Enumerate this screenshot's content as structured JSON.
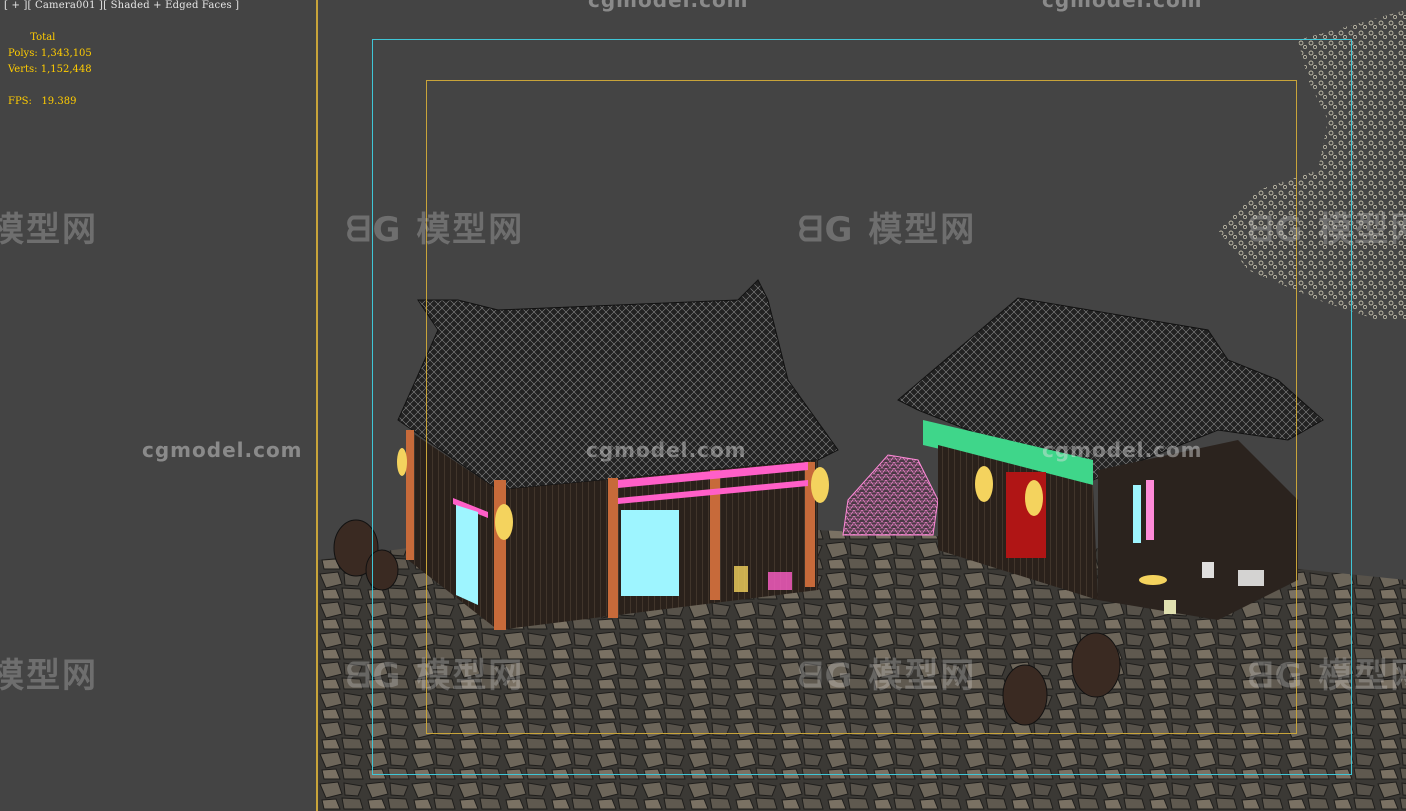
{
  "viewport": {
    "label": "[ + ][ Camera001 ][ Shaded + Edged Faces ]",
    "shading_mode": "Shaded + Edged Faces",
    "camera": "Camera001"
  },
  "stats": {
    "header": "Total",
    "polys_label": "Polys:",
    "polys_value": "1,343,105",
    "verts_label": "Verts:",
    "verts_value": "1,152,448",
    "fps_label": "FPS:",
    "fps_value": "19.389"
  },
  "watermarks": {
    "url": "cgmodel.com",
    "logo": "模型网",
    "logo_mark": "ᗺG"
  },
  "colors": {
    "background": "#444444",
    "stats_text": "#ffcc00",
    "safe_frame_outer": "#3fc6d6",
    "safe_frame_inner": "#c8a43a",
    "wire_pink": "#ff5fc8",
    "wire_cyan": "#9ef5ff",
    "lantern": "#f4d35e",
    "beam_green": "#3fd68a"
  }
}
